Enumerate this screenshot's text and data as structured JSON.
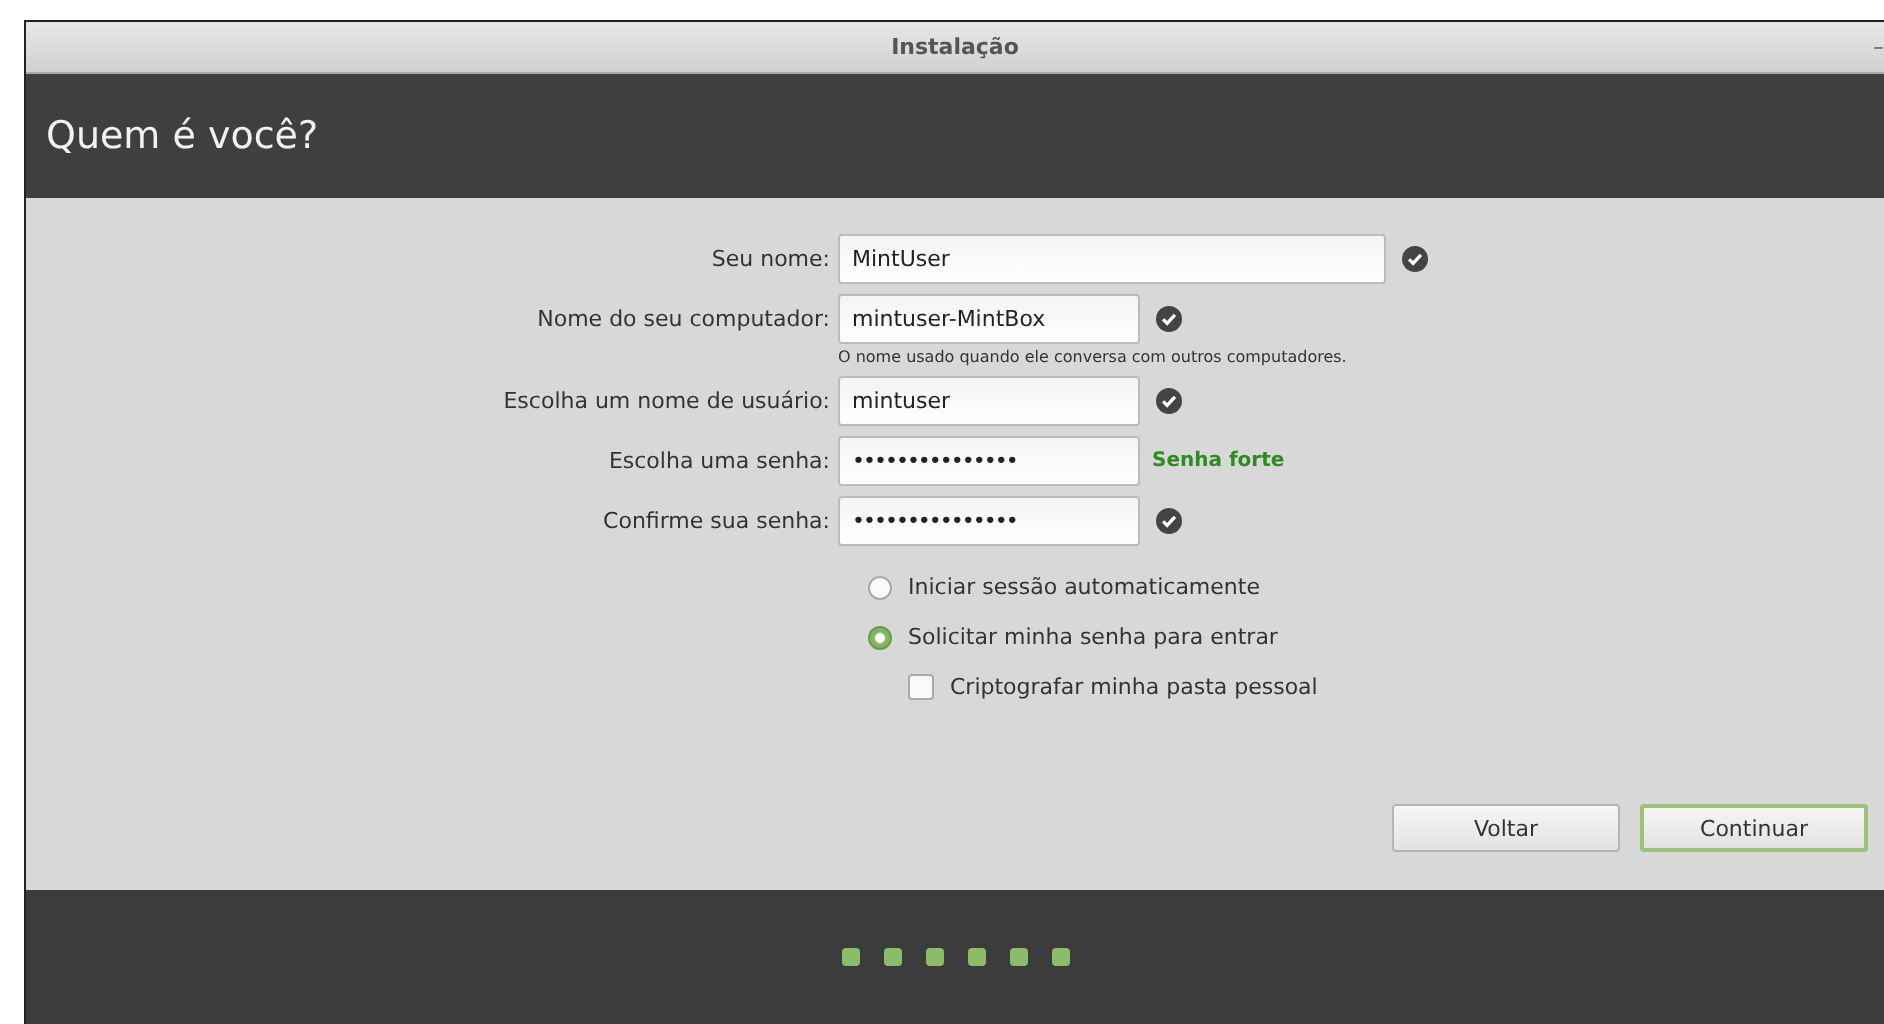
{
  "window": {
    "title": "Instalação",
    "minimize": "–"
  },
  "header": {
    "title": "Quem é você?"
  },
  "fields": [
    {
      "label": "Seu nome:",
      "kind": "text",
      "value": "MintUser",
      "wide": true,
      "status": {
        "kind": "check"
      }
    },
    {
      "label": "Nome do seu computador:",
      "kind": "text",
      "value": "mintuser-MintBox",
      "wide": false,
      "status": {
        "kind": "check"
      },
      "hint": "O nome usado quando ele conversa com outros computadores."
    },
    {
      "label": "Escolha um nome de usuário:",
      "kind": "text",
      "value": "mintuser",
      "wide": false,
      "status": {
        "kind": "check"
      }
    },
    {
      "label": "Escolha uma senha:",
      "kind": "password",
      "value": "•••••••••••••••",
      "wide": false,
      "status": {
        "kind": "strength",
        "text": "Senha forte"
      }
    },
    {
      "label": "Confirme sua senha:",
      "kind": "password",
      "value": "•••••••••••••••",
      "wide": false,
      "status": {
        "kind": "check"
      }
    }
  ],
  "login_options": [
    {
      "label": "Iniciar sessão automaticamente",
      "selected": false
    },
    {
      "label": "Solicitar minha senha para entrar",
      "selected": true
    }
  ],
  "encrypt": {
    "label": "Criptografar minha pasta pessoal",
    "checked": false
  },
  "buttons": [
    {
      "label": "Voltar",
      "default": false
    },
    {
      "label": "Continuar",
      "default": true
    }
  ],
  "progress": [
    {
      "done": true
    },
    {
      "done": true
    },
    {
      "done": true
    },
    {
      "done": true
    },
    {
      "done": true
    },
    {
      "done": true
    }
  ]
}
